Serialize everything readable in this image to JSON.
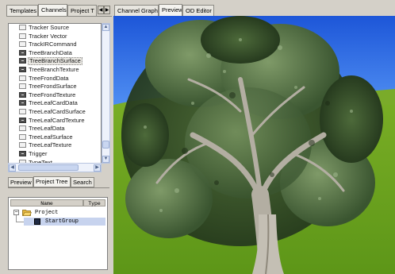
{
  "left_tabs": [
    "Templates",
    "Channels",
    "Project T"
  ],
  "left_active_tab": "Channels",
  "right_tabs": [
    "Channel Graph",
    "Preview",
    "OD Editor"
  ],
  "right_active_tab": "Preview",
  "channel_list": [
    {
      "label": "Tracker Source",
      "icon": "light"
    },
    {
      "label": "Tracker Vector",
      "icon": "light"
    },
    {
      "label": "TrackIRCommand",
      "icon": "light"
    },
    {
      "label": "TreeBranchData",
      "icon": "dark"
    },
    {
      "label": "TreeBranchSurface",
      "icon": "dark",
      "selected": true
    },
    {
      "label": "TreeBranchTexture",
      "icon": "dark"
    },
    {
      "label": "TreeFrondData",
      "icon": "light"
    },
    {
      "label": "TreeFrondSurface",
      "icon": "light"
    },
    {
      "label": "TreeFrondTexture",
      "icon": "dark"
    },
    {
      "label": "TreeLeafCardData",
      "icon": "dark"
    },
    {
      "label": "TreeLeafCardSurface",
      "icon": "light"
    },
    {
      "label": "TreeLeafCardTexture",
      "icon": "dark"
    },
    {
      "label": "TreeLeafData",
      "icon": "light"
    },
    {
      "label": "TreeLeafSurface",
      "icon": "light"
    },
    {
      "label": "TreeLeafTexture",
      "icon": "light"
    },
    {
      "label": "Trigger",
      "icon": "dark"
    },
    {
      "label": "TypeText",
      "icon": "light"
    }
  ],
  "bottom_tabs": [
    "Preview",
    "Project Tree",
    "Search"
  ],
  "bottom_active_tab": "Project Tree",
  "tree_columns": {
    "name": "Name",
    "type": "Type"
  },
  "tree_nodes": {
    "root": "Project",
    "child": "StartGroup"
  },
  "colors": {
    "sky": "#2a66e0",
    "grass": "#6fa41e",
    "selection": "#c7d3ee"
  }
}
